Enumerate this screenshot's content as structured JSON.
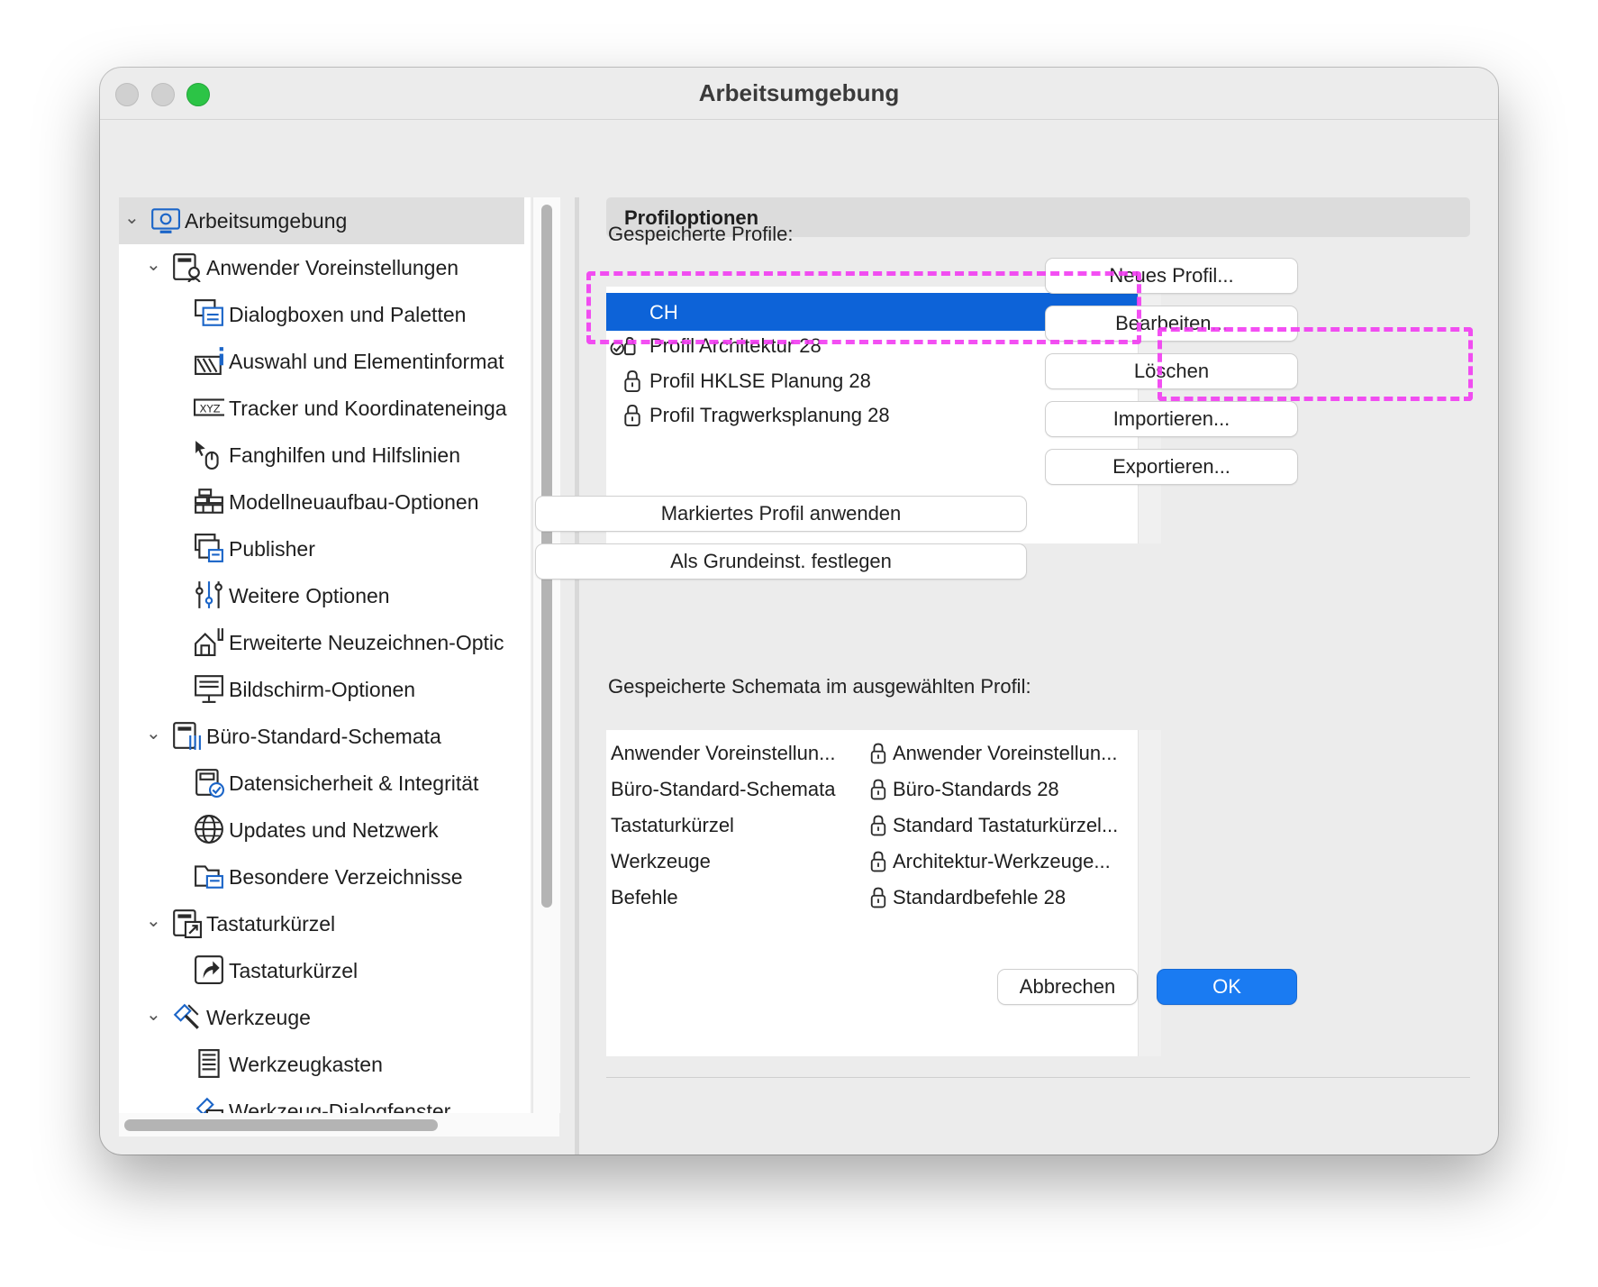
{
  "window": {
    "title": "Arbeitsumgebung"
  },
  "tree": {
    "items": [
      {
        "label": "Arbeitsumgebung",
        "level": 0,
        "expanded": true,
        "selected": true,
        "icon": "workspace-icon"
      },
      {
        "label": "Anwender Voreinstellungen",
        "level": 1,
        "expanded": true,
        "icon": "user-preferences-icon"
      },
      {
        "label": "Dialogboxen und Paletten",
        "level": 2,
        "icon": "dialog-boxes-icon"
      },
      {
        "label": "Auswahl und Elementinformat",
        "level": 2,
        "icon": "selection-info-icon"
      },
      {
        "label": "Tracker und Koordinateneinga",
        "level": 2,
        "icon": "xyz-tracker-icon"
      },
      {
        "label": "Fanghilfen und Hilfslinien",
        "level": 2,
        "icon": "snap-guides-icon"
      },
      {
        "label": "Modellneuaufbau-Optionen",
        "level": 2,
        "icon": "model-rebuild-icon"
      },
      {
        "label": "Publisher",
        "level": 2,
        "icon": "publisher-icon"
      },
      {
        "label": "Weitere Optionen",
        "level": 2,
        "icon": "sliders-icon"
      },
      {
        "label": "Erweiterte Neuzeichnen-Optic",
        "level": 2,
        "icon": "redraw-options-icon"
      },
      {
        "label": "Bildschirm-Optionen",
        "level": 2,
        "icon": "screen-options-icon"
      },
      {
        "label": "Büro-Standard-Schemata",
        "level": 1,
        "expanded": true,
        "icon": "office-standard-icon"
      },
      {
        "label": "Datensicherheit & Integrität",
        "level": 2,
        "icon": "data-safety-icon"
      },
      {
        "label": "Updates und Netzwerk",
        "level": 2,
        "icon": "globe-icon"
      },
      {
        "label": "Besondere Verzeichnisse",
        "level": 2,
        "icon": "folder-icon"
      },
      {
        "label": "Tastaturkürzel",
        "level": 1,
        "expanded": true,
        "icon": "shortcuts-scheme-icon"
      },
      {
        "label": "Tastaturkürzel",
        "level": 2,
        "icon": "shortcut-arrow-icon"
      },
      {
        "label": "Werkzeuge",
        "level": 1,
        "expanded": true,
        "icon": "tools-icon"
      },
      {
        "label": "Werkzeugkasten",
        "level": 2,
        "icon": "toolbox-icon"
      },
      {
        "label": "Werkzeug-Dialogfenster",
        "level": 2,
        "icon": "tool-dialog-icon"
      }
    ]
  },
  "profiles": {
    "section_title": "Profiloptionen",
    "saved_label": "Gespeicherte Profile:",
    "items": [
      {
        "label": "CH",
        "selected": true,
        "locked": false
      },
      {
        "label": "Profil Architektur 28",
        "selected": false,
        "locked": true,
        "active": true
      },
      {
        "label": "Profil HKLSE Planung 28",
        "selected": false,
        "locked": true
      },
      {
        "label": "Profil Tragwerksplanung 28",
        "selected": false,
        "locked": true
      }
    ],
    "buttons": {
      "new": "Neues Profil...",
      "edit": "Bearbeiten...",
      "delete": "Löschen",
      "import": "Importieren...",
      "export": "Exportieren...",
      "apply": "Markiertes Profil anwenden",
      "set_default": "Als Grundeinst. festlegen"
    }
  },
  "schemes": {
    "label": "Gespeicherte Schemata im ausgewählten Profil:",
    "rows": [
      {
        "name": "Anwender Voreinstellun...",
        "value": "Anwender Voreinstellun..."
      },
      {
        "name": "Büro-Standard-Schemata",
        "value": "Büro-Standards 28"
      },
      {
        "name": "Tastaturkürzel",
        "value": "Standard Tastaturkürzel..."
      },
      {
        "name": "Werkzeuge",
        "value": "Architektur-Werkzeuge..."
      },
      {
        "name": "Befehle",
        "value": "Standardbefehle 28"
      }
    ]
  },
  "footer": {
    "cancel": "Abbrechen",
    "ok": "OK"
  },
  "colors": {
    "accent": "#0d63d8",
    "primary_button": "#1a7bf2",
    "highlight_annotation": "#f23cf2",
    "close_light": "#2cc446"
  }
}
